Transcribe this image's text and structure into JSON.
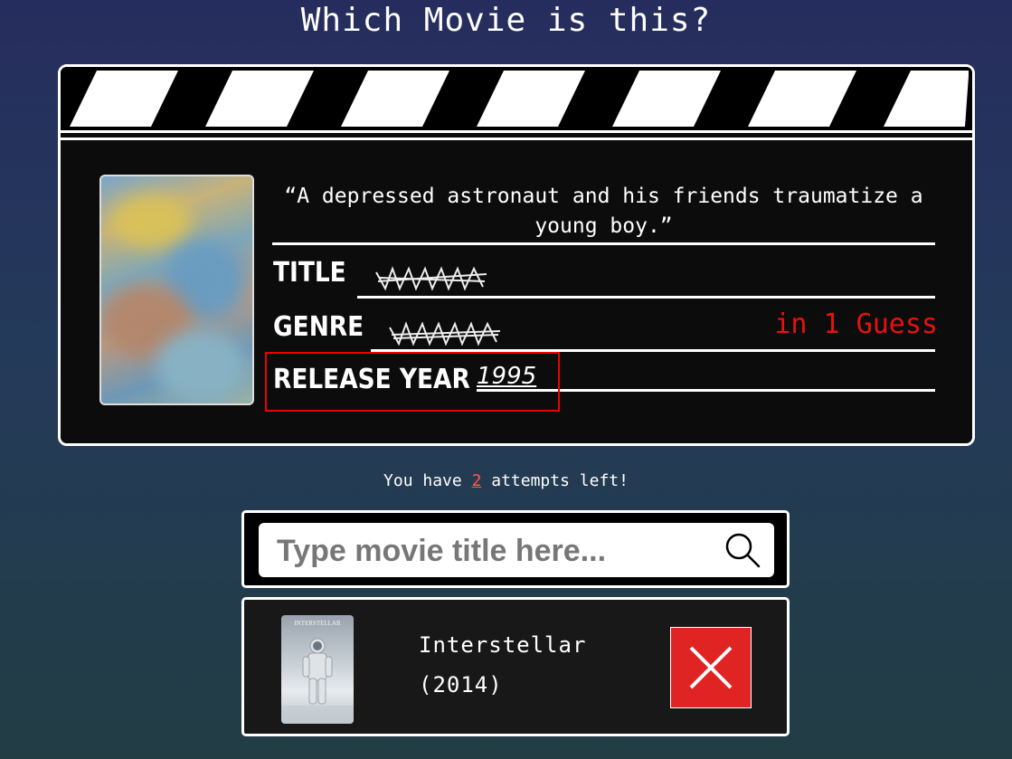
{
  "page": {
    "title": "Which Movie is this?"
  },
  "clue": {
    "tagline": "“A depressed astronaut and his friends traumatize a young boy.”",
    "fields": {
      "title_label": "TITLE",
      "genre_label": "GENRE",
      "year_label": "RELEASE YEAR",
      "year_value": "1995"
    },
    "guess_note": "in 1 Guess"
  },
  "attempts": {
    "prefix": "You have ",
    "count": "2",
    "suffix": " attempts left!"
  },
  "search": {
    "placeholder": "Type movie title here...",
    "value": ""
  },
  "result": {
    "poster_text": "INTERSTELLAR",
    "title": "Interstellar",
    "year": "(2014)",
    "status": "wrong"
  },
  "colors": {
    "accent_red": "#e8110f",
    "background_top": "#262d5e",
    "background_bottom": "#223d44"
  },
  "icons": {
    "search": "search-icon",
    "wrong": "close-icon"
  }
}
